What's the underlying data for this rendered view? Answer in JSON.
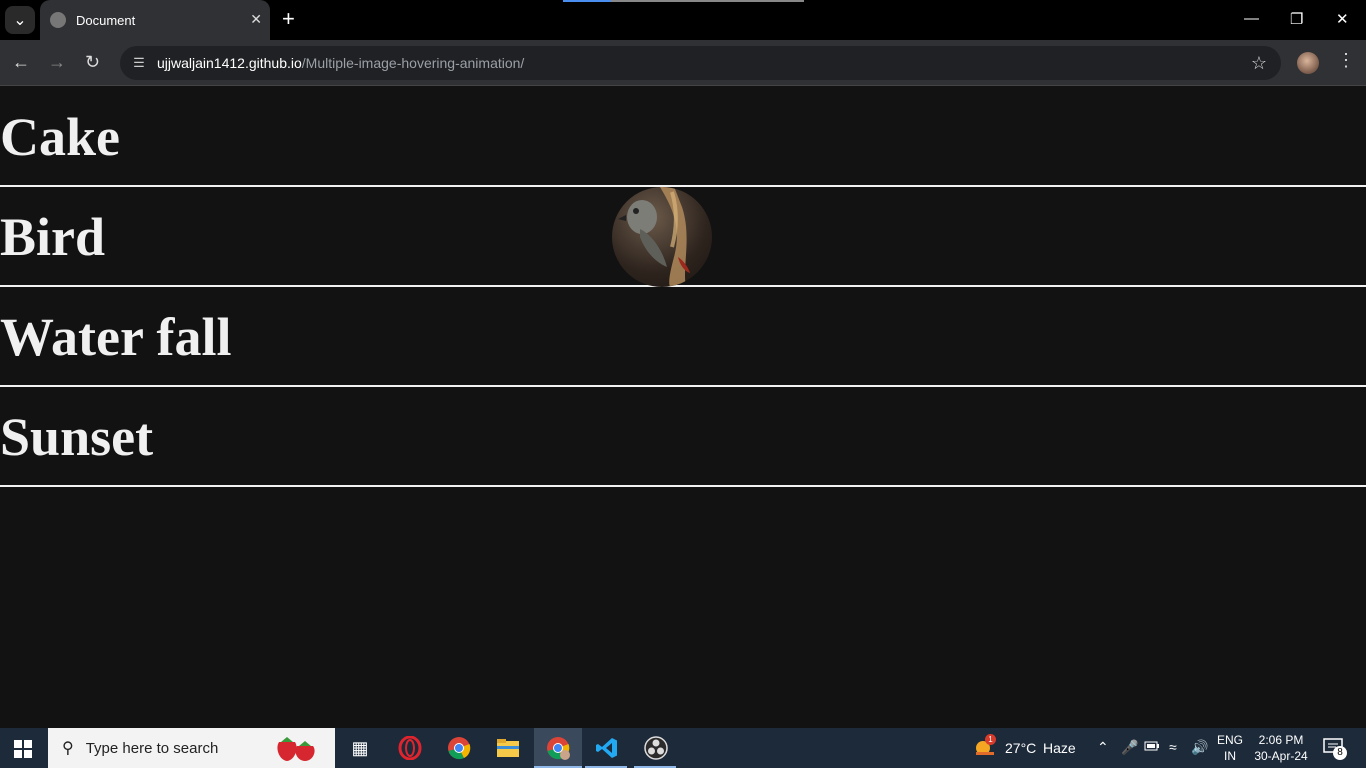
{
  "browser": {
    "tab_title": "Document",
    "url_host": "ujjwaljain1412.github.io",
    "url_path": "/Multiple-image-hovering-animation/"
  },
  "page": {
    "items": [
      {
        "label": "Cake"
      },
      {
        "label": "Bird"
      },
      {
        "label": "Water fall"
      },
      {
        "label": "Sunset"
      }
    ],
    "hover_image": {
      "icon": "bird-photo",
      "row": "Bird"
    }
  },
  "taskbar": {
    "search_placeholder": "Type here to search",
    "weather_temp": "27°C",
    "weather_desc": "Haze",
    "weather_badge": "1",
    "lang_line1": "ENG",
    "lang_line2": "IN",
    "time": "2:06 PM",
    "date": "30-Apr-24",
    "notification_count": "8"
  }
}
